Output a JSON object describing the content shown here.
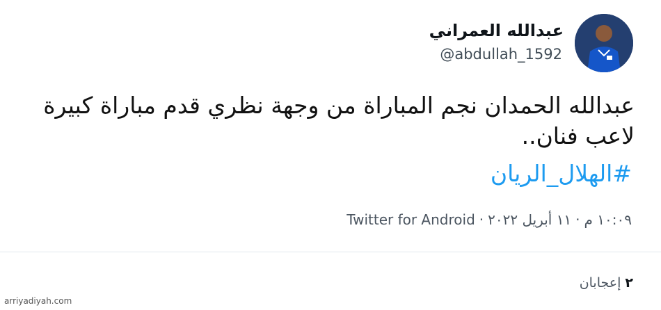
{
  "tweet": {
    "display_name": "عبدالله العمراني",
    "handle": "@abdullah_1592",
    "text": "عبدالله الحمدان نجم المباراة من وجهة نظري قدم مباراة كبيرة لاعب فنان..",
    "hashtag": "#الهلال_الريان",
    "time": "١٠:٠٩ م",
    "date": "١١ أبريل ٢٠٢٢",
    "separator": "·",
    "source": "Twitter for Android",
    "likes_count": "٢",
    "likes_label": "إعجابان"
  },
  "watermark": "arriyadiyah.com",
  "colors": {
    "hashtag": "#1d9bf0",
    "divider": "#e1e8ed",
    "avatar": "#1e3f74"
  }
}
